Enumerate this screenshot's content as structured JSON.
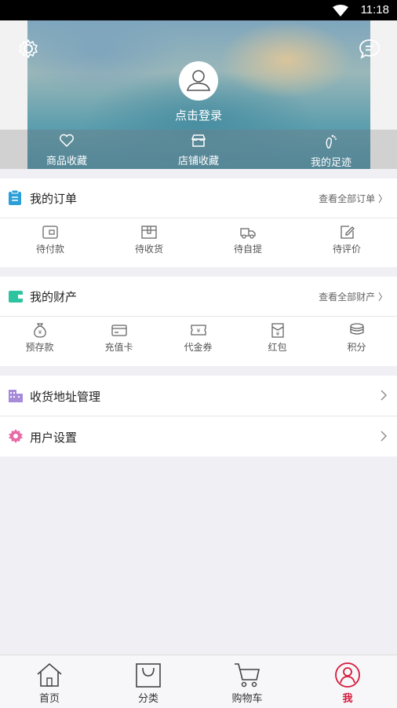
{
  "status": {
    "time": "11:18"
  },
  "hero": {
    "login": "点击登录",
    "favorites": [
      {
        "label": "商品收藏",
        "icon": "heart-icon"
      },
      {
        "label": "店铺收藏",
        "icon": "shop-icon"
      },
      {
        "label": "我的足迹",
        "icon": "footprint-icon"
      }
    ]
  },
  "orders": {
    "title": "我的订单",
    "more": "查看全部订单",
    "items": [
      {
        "label": "待付款",
        "icon": "wallet-icon"
      },
      {
        "label": "待收货",
        "icon": "package-icon"
      },
      {
        "label": "待自提",
        "icon": "truck-icon"
      },
      {
        "label": "待评价",
        "icon": "edit-icon"
      }
    ]
  },
  "assets": {
    "title": "我的财产",
    "more": "查看全部财产",
    "items": [
      {
        "label": "预存款",
        "icon": "money-bag-icon"
      },
      {
        "label": "充值卡",
        "icon": "card-icon"
      },
      {
        "label": "代金券",
        "icon": "voucher-icon"
      },
      {
        "label": "红包",
        "icon": "red-envelope-icon"
      },
      {
        "label": "积分",
        "icon": "points-icon"
      }
    ]
  },
  "menu": {
    "address": "收货地址管理",
    "settings": "用户设置"
  },
  "tabs": [
    {
      "label": "首页",
      "icon": "home-icon"
    },
    {
      "label": "分类",
      "icon": "category-bag-icon"
    },
    {
      "label": "购物车",
      "icon": "cart-icon"
    },
    {
      "label": "我",
      "icon": "user-icon"
    }
  ],
  "colors": {
    "accent": "#d61a3c",
    "orderIcon": "#2a9fd8",
    "walletIcon": "#2ec4a0",
    "addressIcon": "#a78bd9",
    "settingsIcon": "#e86aa6"
  }
}
